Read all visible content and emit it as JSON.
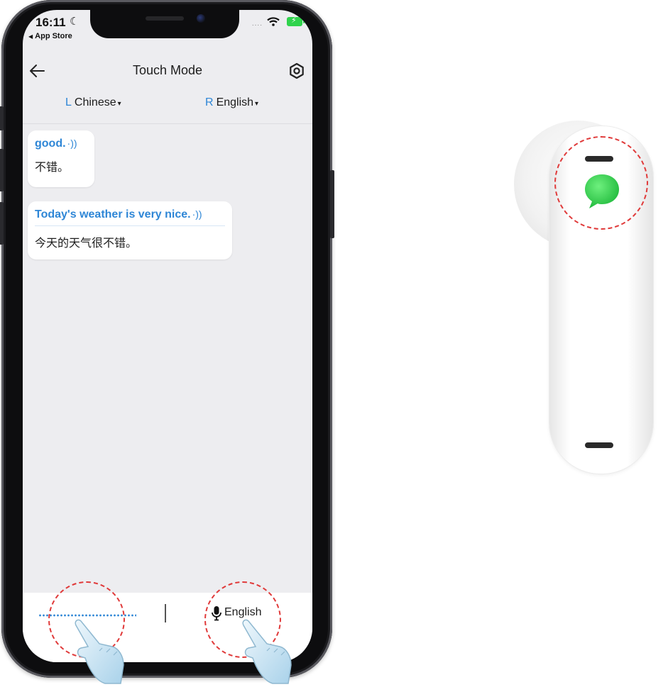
{
  "status_bar": {
    "time": "16:11",
    "back_app": "App Store",
    "signal": "....",
    "battery_symbol": "⚡"
  },
  "nav": {
    "title": "Touch Mode"
  },
  "languages": {
    "left_tag": "L",
    "left_name": "Chinese",
    "right_tag": "R",
    "right_name": "English",
    "caret": "▾"
  },
  "messages": [
    {
      "source": "good.",
      "translation": "不错。"
    },
    {
      "source": "Today's weather is very nice.",
      "translation": "今天的天气很不错。"
    }
  ],
  "speaker_glyph": "·))",
  "bottom_bar": {
    "mic_label": "English"
  },
  "colors": {
    "accent_blue": "#2e86d6",
    "highlight_red": "#e03a3a",
    "earbud_led_green": "#2ccf4a"
  },
  "icons": [
    "back-arrow-icon",
    "settings-icon",
    "speaker-icon",
    "mic-icon",
    "hand-pointer-icon",
    "message-icon",
    "wifi-icon",
    "battery-icon",
    "moon-icon"
  ]
}
